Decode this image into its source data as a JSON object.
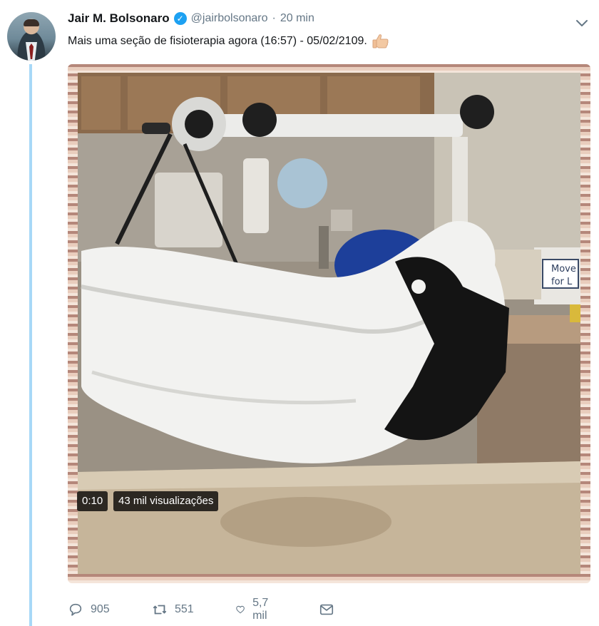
{
  "tweet": {
    "author_name": "Jair M. Bolsonaro",
    "handle": "@jairbolsonaro",
    "separator": "·",
    "time": "20 min",
    "verified_icon": "verified-badge-icon",
    "text": "Mais uma seção de fisioterapia agora (16:57) - 05/02/2109.",
    "emoji": "thumbs-up-icon"
  },
  "media": {
    "duration": "0:10",
    "views": "43 mil visualizações",
    "sign_text_line1": "Move",
    "sign_text_line2": "for L"
  },
  "actions": {
    "reply_count": "905",
    "retweet_count": "551",
    "like_count": "5,7 mil"
  },
  "colors": {
    "accent": "#1da1f2",
    "thread_line": "#a7d8f7",
    "muted_text": "#657786"
  }
}
